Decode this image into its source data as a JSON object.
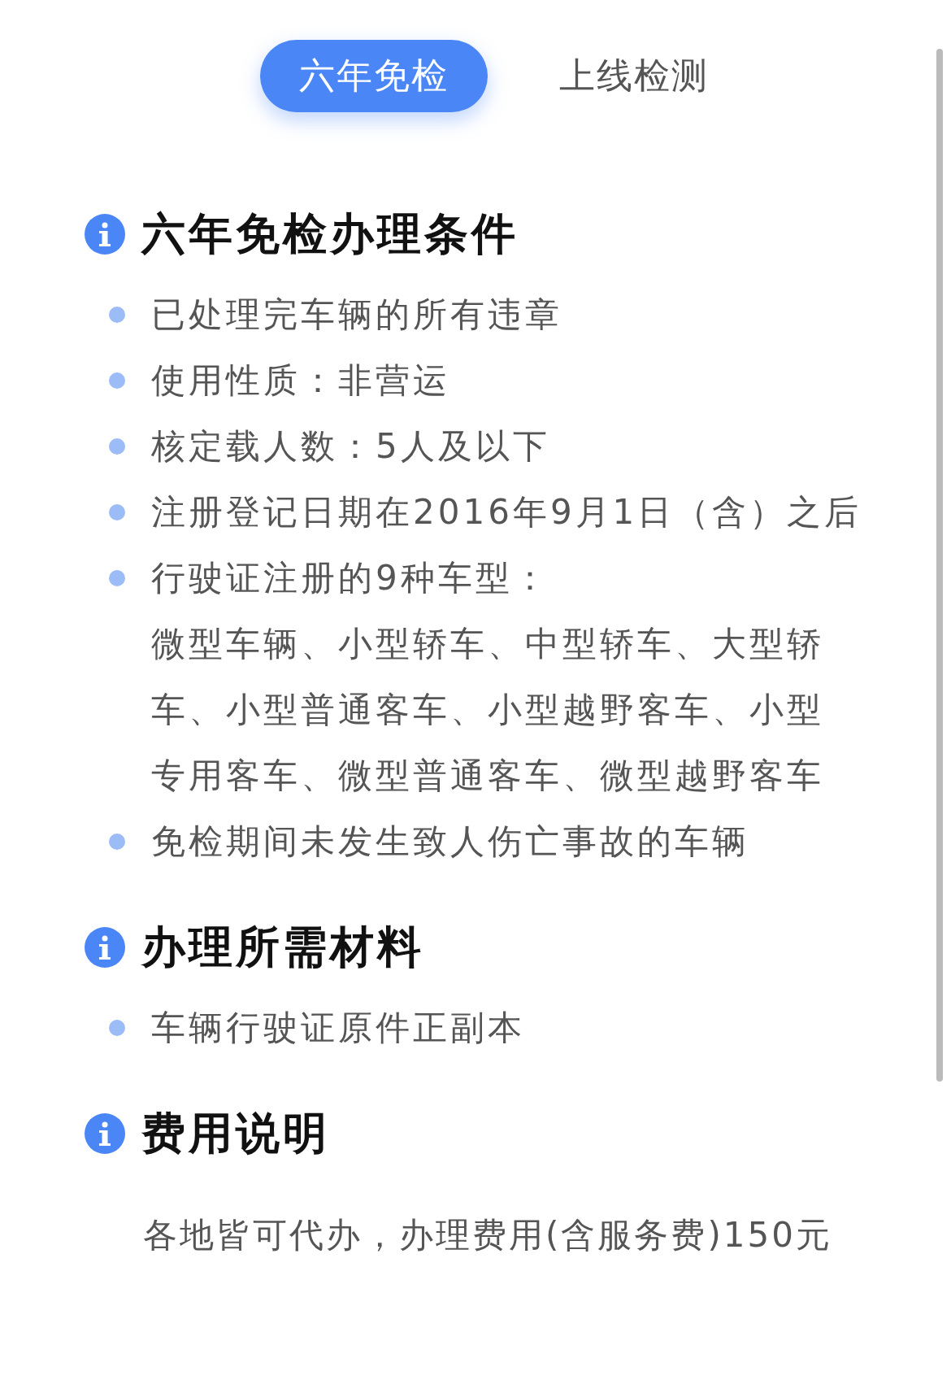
{
  "tabs": [
    {
      "label": "六年免检",
      "selected": true
    },
    {
      "label": "上线检测",
      "selected": false
    }
  ],
  "sections": [
    {
      "title": "六年免检办理条件",
      "kind": "list",
      "items": [
        {
          "text": "已处理完车辆的所有违章"
        },
        {
          "text": "使用性质：非营运"
        },
        {
          "text": "核定载人数：5人及以下"
        },
        {
          "text": "注册登记日期在2016年9月1日（含）之后"
        },
        {
          "text": "行驶证注册的9种车型：",
          "detail": "微型车辆、小型轿车、中型轿车、大型轿车、小型普通客车、小型越野客车、小型专用客车、微型普通客车、微型越野客车"
        },
        {
          "text": "免检期间未发生致人伤亡事故的车辆"
        }
      ]
    },
    {
      "title": "办理所需材料",
      "kind": "list",
      "items": [
        {
          "text": "车辆行驶证原件正副本"
        }
      ]
    },
    {
      "title": "费用说明",
      "kind": "text",
      "body": "各地皆可代办，办理费用(含服务费)150元"
    }
  ]
}
